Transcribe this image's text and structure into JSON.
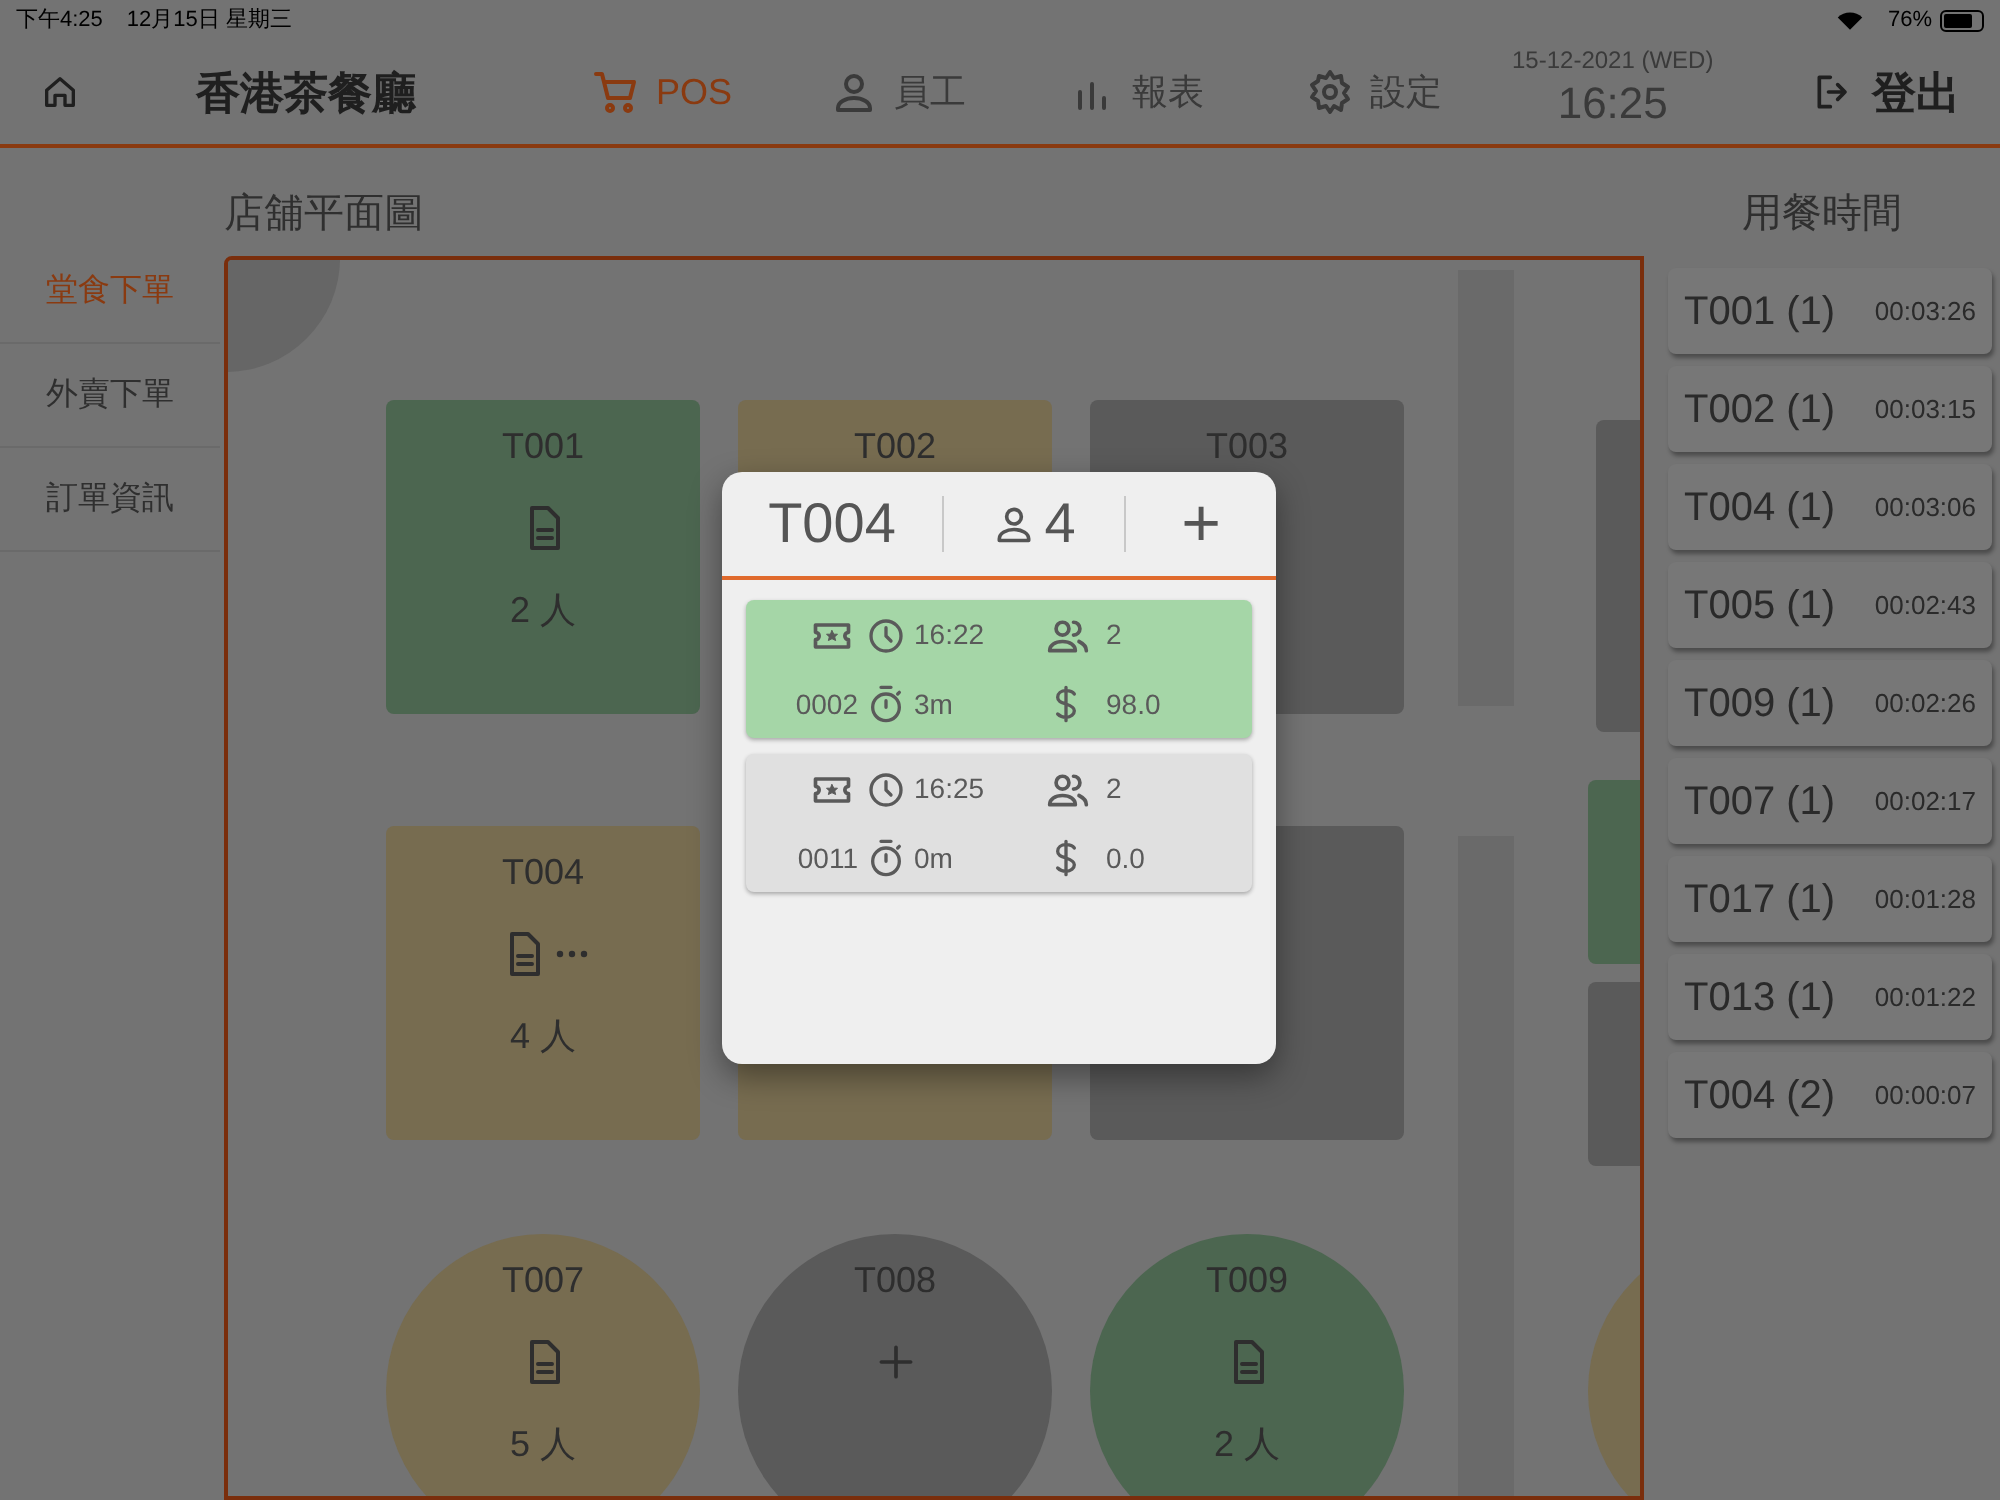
{
  "status_bar": {
    "time": "下午4:25",
    "date": "12月15日 星期三",
    "battery": "76%"
  },
  "nav": {
    "title": "香港茶餐廳",
    "tabs": [
      {
        "label": "POS",
        "selected": true
      },
      {
        "label": "員工",
        "selected": false
      },
      {
        "label": "報表",
        "selected": false
      },
      {
        "label": "設定",
        "selected": false
      }
    ],
    "date": "15-12-2021 (WED)",
    "time": "16:25",
    "logout": "登出"
  },
  "sidebar": {
    "items": [
      {
        "label": "堂食下單",
        "selected": true
      },
      {
        "label": "外賣下單",
        "selected": false
      },
      {
        "label": "訂單資訊",
        "selected": false
      }
    ]
  },
  "floor_plan": {
    "title": "店舖平面圖",
    "tables": [
      {
        "label": "T001",
        "kind": "square",
        "color": "#4c6650",
        "occupied": true,
        "more_orders": false,
        "people": "2 人"
      },
      {
        "label": "T002",
        "kind": "square",
        "color": "#776c50"
      },
      {
        "label": "T003",
        "kind": "square",
        "color": "#5a5a5a"
      },
      {
        "label": "T004",
        "kind": "square",
        "color": "#776c50",
        "occupied": true,
        "more_orders": true,
        "people": "4 人"
      },
      {
        "kind": "square",
        "color": "#776c50"
      },
      {
        "kind": "square",
        "color": "#5a5a5a"
      },
      {
        "label": "T007",
        "kind": "round",
        "color": "#776c50",
        "occupied": true,
        "more_orders": false,
        "people": "5 人"
      },
      {
        "label": "T008",
        "kind": "round",
        "color": "#5a5a5a",
        "occupied": false,
        "more_orders": false
      },
      {
        "label": "T009",
        "kind": "round",
        "color": "#4c6650",
        "occupied": true,
        "more_orders": false,
        "people": "2 人"
      }
    ]
  },
  "dining_time": {
    "title": "用餐時間",
    "items": [
      {
        "table": "T001 (1)",
        "time": "00:03:26"
      },
      {
        "table": "T002 (1)",
        "time": "00:03:15"
      },
      {
        "table": "T004 (1)",
        "time": "00:03:06"
      },
      {
        "table": "T005 (1)",
        "time": "00:02:43"
      },
      {
        "table": "T009 (1)",
        "time": "00:02:26"
      },
      {
        "table": "T007 (1)",
        "time": "00:02:17"
      },
      {
        "table": "T017 (1)",
        "time": "00:01:28"
      },
      {
        "table": "T013 (1)",
        "time": "00:01:22"
      },
      {
        "table": "T004 (2)",
        "time": "00:00:07"
      }
    ]
  },
  "popup": {
    "table": "T004",
    "guests": "4",
    "add": "+",
    "orders": [
      {
        "number": "0002",
        "start": "16:22",
        "guests": "2",
        "elapsed": "3m",
        "amount": "98.0",
        "paid": true
      },
      {
        "number": "0011",
        "start": "16:25",
        "guests": "2",
        "elapsed": "0m",
        "amount": "0.0",
        "paid": false
      }
    ]
  }
}
